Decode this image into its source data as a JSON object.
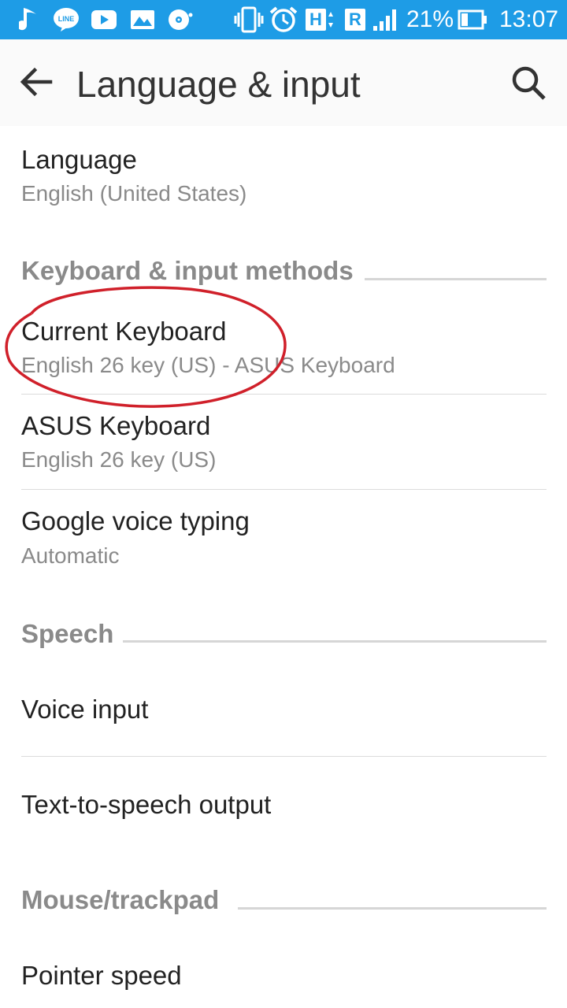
{
  "status_bar": {
    "icons": [
      "music-note-icon",
      "line-app-icon",
      "youtube-icon",
      "gallery-icon",
      "disc-icon",
      "vibrate-icon",
      "alarm-icon",
      "signal-h-icon",
      "roaming-r-icon",
      "signal-strength-icon",
      "battery-icon"
    ],
    "h_label": "H",
    "r_label": "R",
    "battery_percent": "21%",
    "time": "13:07",
    "color": "#1e9ce6"
  },
  "header": {
    "title": "Language & input"
  },
  "items": {
    "language": {
      "title": "Language",
      "subtitle": "English (United States)"
    },
    "current_keyboard": {
      "title": "Current Keyboard",
      "subtitle": "English 26 key (US) - ASUS Keyboard"
    },
    "asus_keyboard": {
      "title": "ASUS Keyboard",
      "subtitle": "English 26 key (US)"
    },
    "google_voice": {
      "title": "Google voice typing",
      "subtitle": "Automatic"
    },
    "voice_input": {
      "title": "Voice input"
    },
    "tts_output": {
      "title": "Text-to-speech output"
    },
    "pointer_speed": {
      "title": "Pointer speed"
    }
  },
  "sections": {
    "keyboard": "Keyboard & input methods",
    "speech": "Speech",
    "mouse": "Mouse/trackpad"
  },
  "annotation": {
    "color": "#d0202a"
  }
}
